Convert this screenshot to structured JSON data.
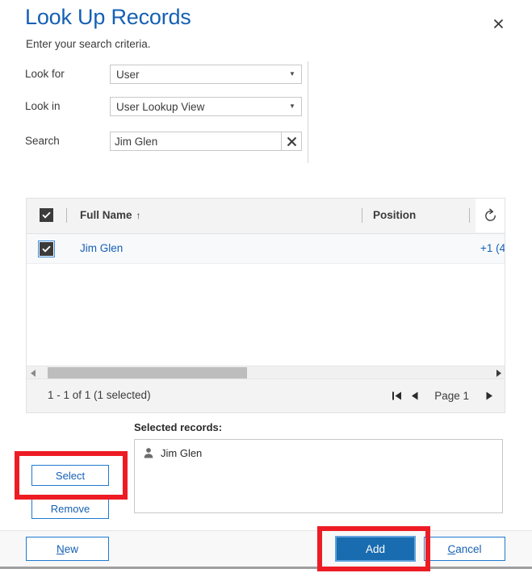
{
  "dialog": {
    "title": "Look Up Records",
    "subtitle": "Enter your search criteria.",
    "close_icon": "close-icon"
  },
  "criteria": {
    "look_for": {
      "label": "Look for",
      "value": "User",
      "caret_icon": "chevron-down-icon"
    },
    "look_in": {
      "label": "Look in",
      "value": "User Lookup View",
      "caret_icon": "chevron-down-icon"
    },
    "search": {
      "label": "Search",
      "value": "Jim Glen",
      "placeholder": "",
      "clear_icon": "clear-x-icon"
    }
  },
  "grid": {
    "select_all_checked": true,
    "columns": [
      {
        "label": "Full Name",
        "sort": "ascending",
        "sort_icon": "arrow-up-icon"
      },
      {
        "label": "Position",
        "sort": "none"
      }
    ],
    "refresh_icon": "refresh-icon",
    "rows": [
      {
        "checked": true,
        "full_name": "Jim Glen",
        "position": "+1 (4"
      }
    ],
    "scrollbar": {
      "left_icon": "triangle-left-icon",
      "right_icon": "triangle-right-icon"
    },
    "footer": {
      "count_text": "1 - 1 of 1 (1 selected)",
      "first_page_icon": "first-page-icon",
      "prev_page_icon": "prev-page-icon",
      "page_label": "Page 1",
      "next_page_icon": "next-page-icon"
    }
  },
  "selected_records": {
    "label": "Selected records:",
    "items": [
      {
        "icon": "user-icon",
        "name": "Jim Glen"
      }
    ]
  },
  "side_buttons": {
    "select": "Select",
    "remove": "Remove"
  },
  "footer_buttons": {
    "new": {
      "accel": "N",
      "rest": "ew"
    },
    "add": "Add",
    "cancel": {
      "accel": "C",
      "rest": "ancel"
    }
  },
  "colors": {
    "title_blue": "#1560b4",
    "link_blue": "#1560b4",
    "button_border_blue": "#1f7ad0",
    "primary_button_bg": "#1a6cb0",
    "primary_button_border": "#5ea2dd",
    "highlight_red": "#ed1c24",
    "grid_header_bg": "#f3f3f3",
    "row_bg": "#f8f9fb"
  }
}
